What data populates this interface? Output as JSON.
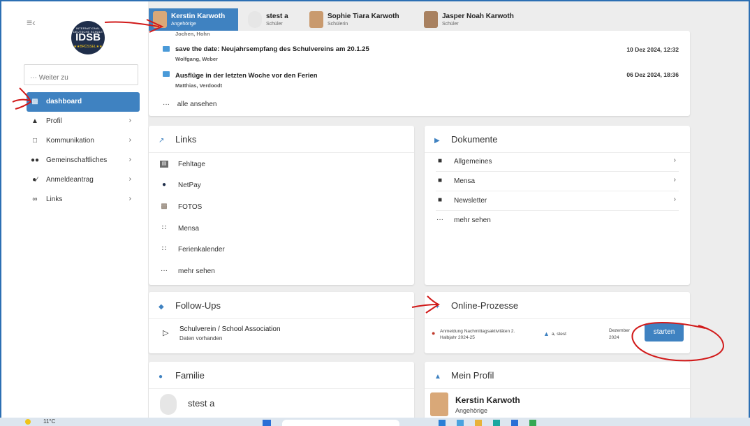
{
  "sidebar": {
    "collapse_icon": "menu-collapse-icon",
    "logo": {
      "small": "INTERNATIONAL DEUTSCHE SCHULE",
      "big": "IDSB",
      "stars": "★★BRÜSSEL★★"
    },
    "search_placeholder": "··· Weiter zu",
    "items": [
      {
        "label": "dashboard",
        "icon": "dashboard-icon"
      },
      {
        "label": "Profil",
        "icon": "person-icon"
      },
      {
        "label": "Kommunikation",
        "icon": "chat-icon"
      },
      {
        "label": "Gemeinschaftliches",
        "icon": "group-icon"
      },
      {
        "label": "Anmeldeantrag",
        "icon": "register-icon"
      },
      {
        "label": "Links",
        "icon": "link-icon"
      }
    ]
  },
  "tabs": [
    {
      "name": "Kerstin Karwoth",
      "role": "Angehörige"
    },
    {
      "name": "stest a",
      "role": "Schüler"
    },
    {
      "name": "Sophie Tiara Karwoth",
      "role": "Schülerin"
    },
    {
      "name": "Jasper Noah Karwoth",
      "role": "Schüler"
    }
  ],
  "messages": {
    "cut_author": "Jochen, Hohn",
    "items": [
      {
        "title": "save the date: Neujahrsempfang des Schulvereins am 20.1.25",
        "author": "Wolfgang, Weber",
        "date": "10 Dez 2024, 12:32"
      },
      {
        "title": "Ausflüge in der letzten Woche vor den Ferien",
        "author": "Matthias, Verdoodt",
        "date": "06 Dez 2024, 18:36"
      }
    ],
    "view_all": "alle ansehen"
  },
  "links": {
    "title": "Links",
    "items": [
      "Fehltage",
      "NetPay",
      "FOTOS",
      "Mensa",
      "Ferienkalender"
    ],
    "more": "mehr sehen"
  },
  "documents": {
    "title": "Dokumente",
    "items": [
      "Allgemeines",
      "Mensa",
      "Newsletter"
    ],
    "more": "mehr sehen"
  },
  "followups": {
    "title": "Follow-Ups",
    "item_title": "Schulverein / School Association",
    "item_sub": "Daten vorhanden"
  },
  "online": {
    "title": "Online-Prozesse",
    "process": "Anmeldung Nachmittagsaktivitäten 2. Halbjahr 2024-25",
    "person": "a, stest",
    "date_a": "Dezember",
    "date_b": "2024",
    "button": "starten"
  },
  "family": {
    "title": "Familie",
    "member": "stest a"
  },
  "profile": {
    "title": "Mein Profil",
    "name": "Kerstin Karwoth",
    "role": "Angehörige"
  },
  "taskbar": {
    "temp": "11°C"
  },
  "colors": {
    "accent": "#3f82c1",
    "annotation": "#d11a1a"
  }
}
